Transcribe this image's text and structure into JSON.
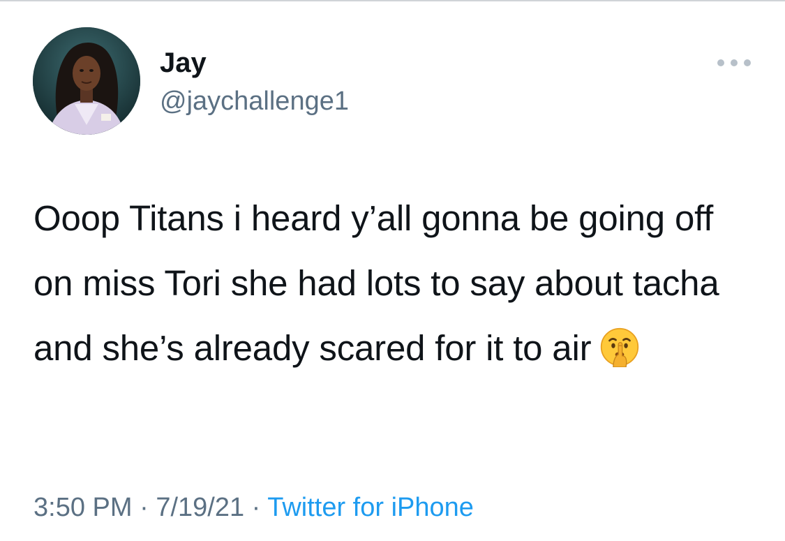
{
  "user": {
    "display_name": "Jay",
    "handle": "@jaychallenge1"
  },
  "tweet": {
    "text": "Ooop Titans i heard y’all gonna be going off on miss Tori she had lots to say about tacha and she’s already scared for it to air",
    "emoji_icon": "shushing-face-icon"
  },
  "meta": {
    "time": "3:50 PM",
    "separator": "·",
    "date": "7/19/21",
    "source": "Twitter for iPhone"
  },
  "colors": {
    "text": "#0f1419",
    "secondary": "#5b7083",
    "link": "#1d9bf0"
  }
}
